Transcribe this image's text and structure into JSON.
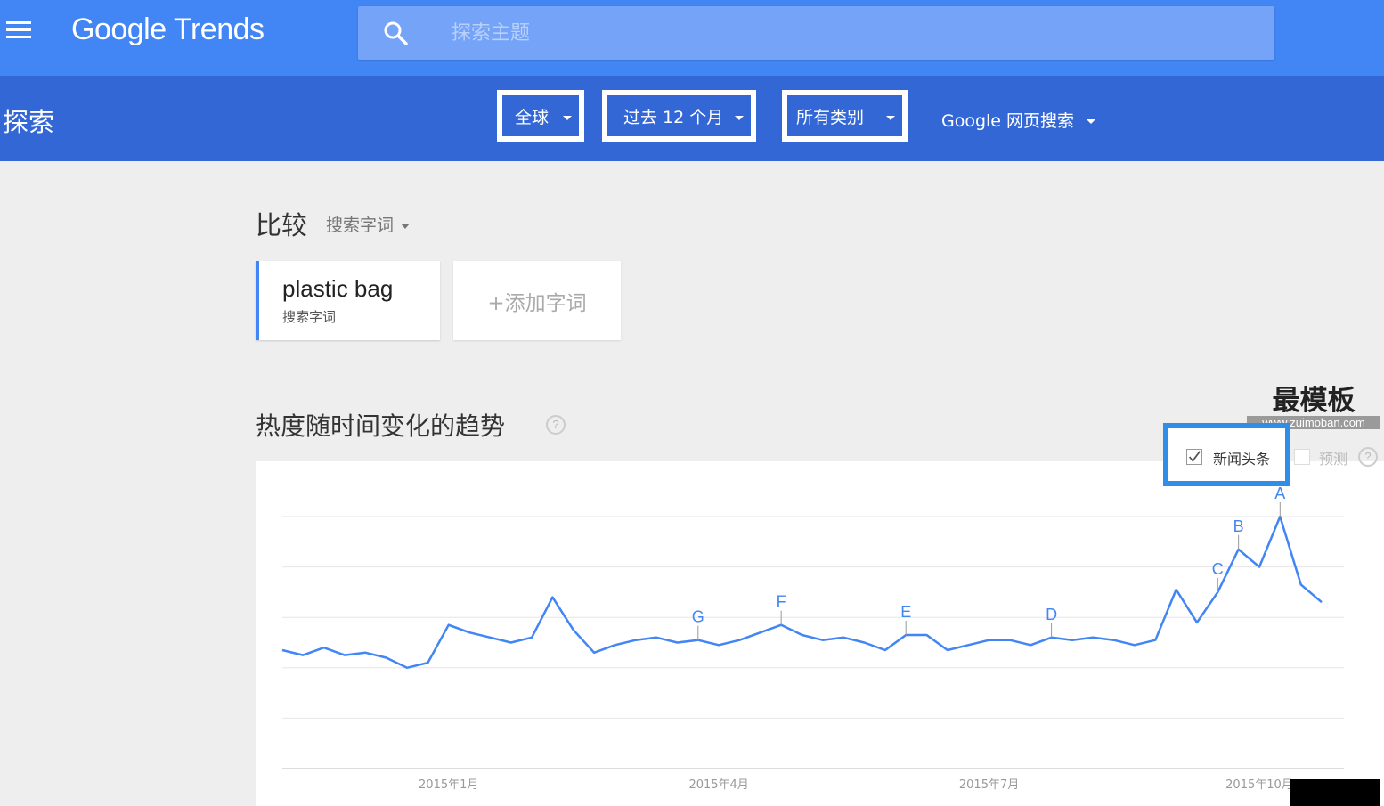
{
  "header": {
    "brand": "Google Trends",
    "search_placeholder": "探索主题"
  },
  "subbar": {
    "title": "探索",
    "filters": [
      {
        "label": "全球"
      },
      {
        "label": "过去 12 个月"
      },
      {
        "label": "所有类别"
      },
      {
        "label": "Google 网页搜索"
      }
    ]
  },
  "compare": {
    "title": "比较",
    "type_label": "搜索字词",
    "terms": [
      {
        "name": "plastic bag",
        "type": "搜索字词"
      }
    ],
    "add_label": "+添加字词"
  },
  "trend": {
    "title": "热度随时间变化的趋势",
    "help": "?",
    "news_label": "新闻头条",
    "news_checked": true,
    "forecast_label": "预测",
    "forecast_checked": false
  },
  "watermark": {
    "main": "最模板",
    "sub": "www.zuimoban.com"
  },
  "colors": {
    "primary": "#4285f4",
    "subbar": "#3367d6",
    "line": "#4285f4",
    "highlight": "#2f8ee8"
  },
  "chart_data": {
    "type": "line",
    "x_tick_labels": [
      "2015年1月",
      "2015年4月",
      "2015年7月",
      "2015年10月"
    ],
    "x_tick_index": [
      8,
      21,
      34,
      47
    ],
    "ylim": [
      0,
      100
    ],
    "grid": true,
    "series": [
      {
        "values": [
          47,
          45,
          48,
          45,
          46,
          44,
          40,
          42,
          57,
          54,
          52,
          50,
          52,
          68,
          55,
          46,
          49,
          51,
          52,
          50,
          51,
          49,
          51,
          54,
          57,
          53,
          51,
          52,
          50,
          47,
          53,
          53,
          47,
          49,
          51,
          51,
          49,
          52,
          51,
          52,
          51,
          49,
          51,
          71,
          58,
          70,
          87,
          80,
          100,
          73,
          66
        ]
      }
    ],
    "annotations": [
      {
        "label": "A",
        "index": 48
      },
      {
        "label": "B",
        "index": 46
      },
      {
        "label": "C",
        "index": 45
      },
      {
        "label": "D",
        "index": 37
      },
      {
        "label": "E",
        "index": 30
      },
      {
        "label": "F",
        "index": 24
      },
      {
        "label": "G",
        "index": 20
      }
    ]
  }
}
